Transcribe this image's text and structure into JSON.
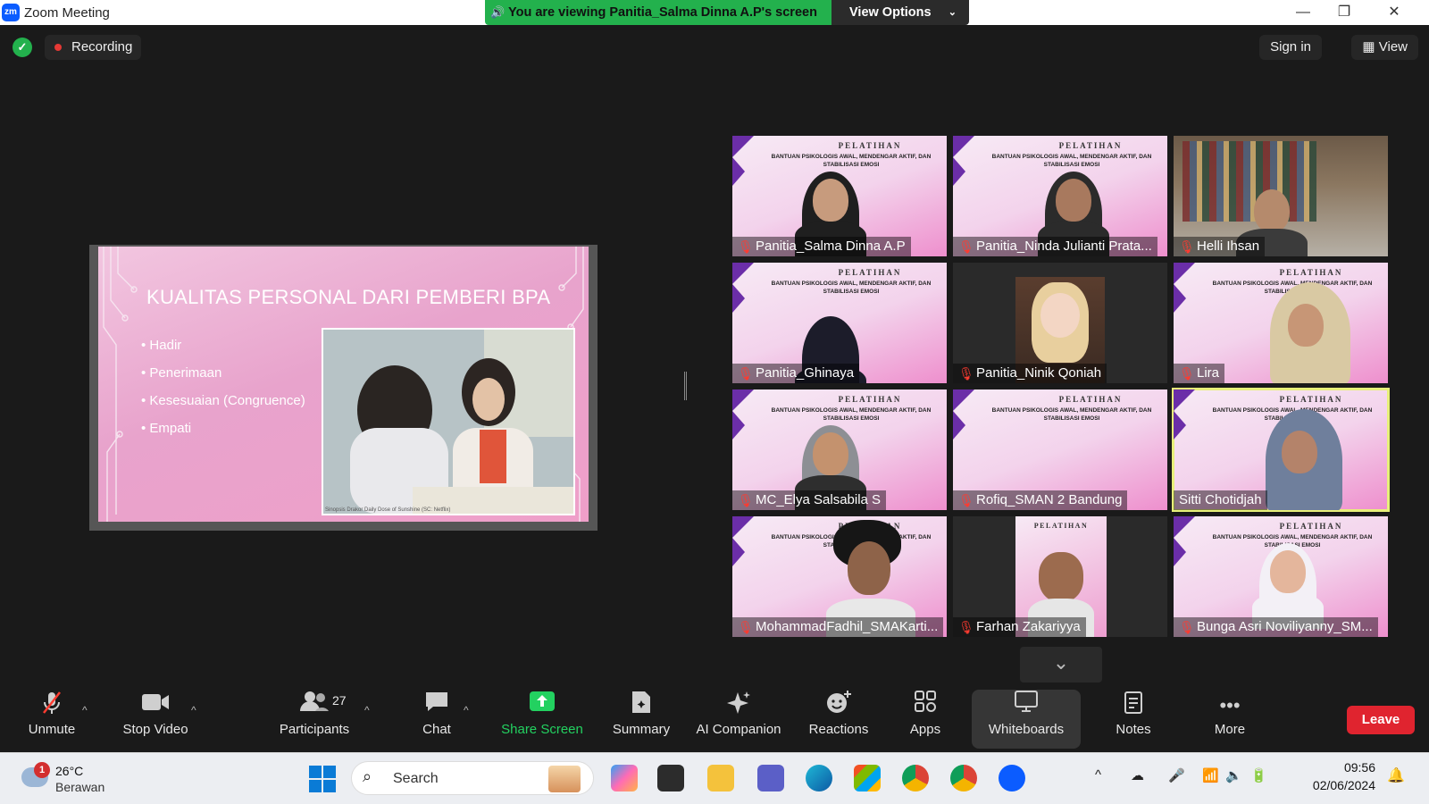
{
  "window": {
    "title": "Zoom Meeting",
    "logo_text": "zm",
    "banner_text": "You are viewing Panitia_Salma Dinna A.P's screen",
    "view_options_label": "View Options",
    "minimize_glyph": "—",
    "maximize_glyph": "❐",
    "close_glyph": "✕"
  },
  "topbar": {
    "recording_label": "Recording",
    "sign_in_label": "Sign in",
    "view_label": "View"
  },
  "shared_slide": {
    "title": "KUALITAS PERSONAL DARI PEMBERI BPA",
    "items": [
      "Hadir",
      "Penerimaan",
      "Kesesuaian (Congruence)",
      "Empati"
    ],
    "caption": "Sinopsis Drakor Daily Dose of Sunshine (SC: Netflix)"
  },
  "tile_header": {
    "brand": "PELATIHAN",
    "subtitle": "BANTUAN PSIKOLOGIS AWAL, MENDENGAR AKTIF, DAN STABILISASI EMOSI"
  },
  "participants": [
    {
      "name": "Panitia_Salma Dinna A.P",
      "muted": true,
      "style": "slide"
    },
    {
      "name": "Panitia_Ninda Julianti Prata...",
      "muted": true,
      "style": "slide"
    },
    {
      "name": "Helli Ihsan",
      "muted": true,
      "style": "room"
    },
    {
      "name": "Panitia_Ghinaya",
      "muted": true,
      "style": "slide"
    },
    {
      "name": "Panitia_Ninik Qoniah",
      "muted": true,
      "style": "avatar"
    },
    {
      "name": "Lira",
      "muted": true,
      "style": "slide"
    },
    {
      "name": "MC_Elya Salsabila S",
      "muted": true,
      "style": "slide"
    },
    {
      "name": "Rofiq_SMAN 2 Bandung",
      "muted": true,
      "style": "slide"
    },
    {
      "name": "Sitti Chotidjah",
      "muted": false,
      "style": "slide",
      "active": true
    },
    {
      "name": "MohammadFadhil_SMAKarti...",
      "muted": true,
      "style": "slide"
    },
    {
      "name": "Farhan Zakariyya",
      "muted": true,
      "style": "narrow"
    },
    {
      "name": "Bunga Asri Noviliyanny_SM...",
      "muted": true,
      "style": "slide"
    }
  ],
  "toolbar": {
    "unmute": "Unmute",
    "stop_video": "Stop Video",
    "participants": "Participants",
    "participants_count": "27",
    "chat": "Chat",
    "share_screen": "Share Screen",
    "summary": "Summary",
    "ai_companion": "AI Companion",
    "reactions": "Reactions",
    "apps": "Apps",
    "whiteboards": "Whiteboards",
    "notes": "Notes",
    "more": "More",
    "leave": "Leave"
  },
  "taskbar": {
    "weather_badge": "1",
    "temperature": "26°C",
    "weather_condition": "Berawan",
    "search_placeholder": "Search",
    "time": "09:56",
    "date": "02/06/2024"
  },
  "colors": {
    "zoom_blue": "#0b5cff",
    "share_green": "#23b14d",
    "leave_red": "#e0242f",
    "active_speaker": "#e8f07a"
  }
}
